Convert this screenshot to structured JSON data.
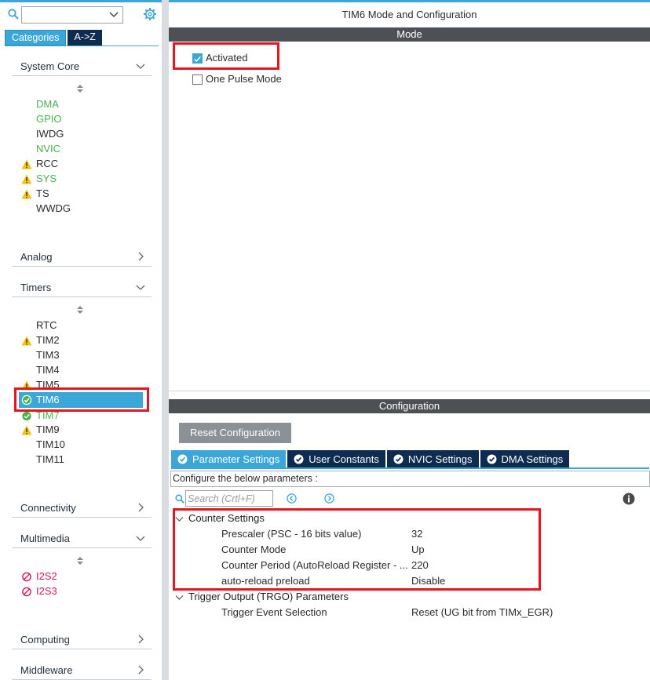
{
  "left_panel": {
    "search": {
      "value": ""
    },
    "tabs": {
      "categories": "Categories",
      "az": "A->Z"
    },
    "sections": {
      "system_core": "System Core",
      "analog": "Analog",
      "timers": "Timers",
      "connectivity": "Connectivity",
      "multimedia": "Multimedia",
      "computing": "Computing",
      "middleware": "Middleware"
    },
    "system_core_items": [
      "DMA",
      "GPIO",
      "IWDG",
      "NVIC",
      "RCC",
      "SYS",
      "TS",
      "WWDG"
    ],
    "timers_items": [
      "RTC",
      "TIM2",
      "TIM3",
      "TIM4",
      "TIM5",
      "TIM6",
      "TIM7",
      "TIM9",
      "TIM10",
      "TIM11"
    ],
    "multimedia_items": [
      "I2S2",
      "I2S3"
    ],
    "selected_item": "TIM6"
  },
  "colors": {
    "accent": "#3aa7d8",
    "dark_tab": "#0d2c4f",
    "ok_green": "#4caf50",
    "warning_yellow": "#f4c20d",
    "error_pink": "#d4145a",
    "highlight_red": "#e8141e",
    "header_bar": "#4d5156"
  },
  "right_panel": {
    "title": "TIM6 Mode and Configuration",
    "mode_bar": "Mode",
    "mode_options": [
      {
        "label": "Activated",
        "checked": true
      },
      {
        "label": "One Pulse Mode",
        "checked": false
      }
    ],
    "config_bar": "Configuration",
    "reset_button": "Reset Configuration",
    "config_tabs": [
      "Parameter Settings",
      "User Constants",
      "NVIC Settings",
      "DMA Settings"
    ],
    "active_tab": "Parameter Settings",
    "description": "Configure the below parameters :",
    "search_placeholder": "Search (Crtl+F)",
    "groups": [
      {
        "name": "Counter Settings",
        "params": [
          {
            "name": "Prescaler (PSC - 16 bits value)",
            "value": "32"
          },
          {
            "name": "Counter Mode",
            "value": "Up"
          },
          {
            "name": "Counter Period (AutoReload Register - ...",
            "value": "220"
          },
          {
            "name": "auto-reload preload",
            "value": "Disable"
          }
        ]
      },
      {
        "name": "Trigger Output (TRGO) Parameters",
        "params": [
          {
            "name": "Trigger Event Selection",
            "value": "Reset (UG bit from TIMx_EGR)"
          }
        ]
      }
    ]
  }
}
